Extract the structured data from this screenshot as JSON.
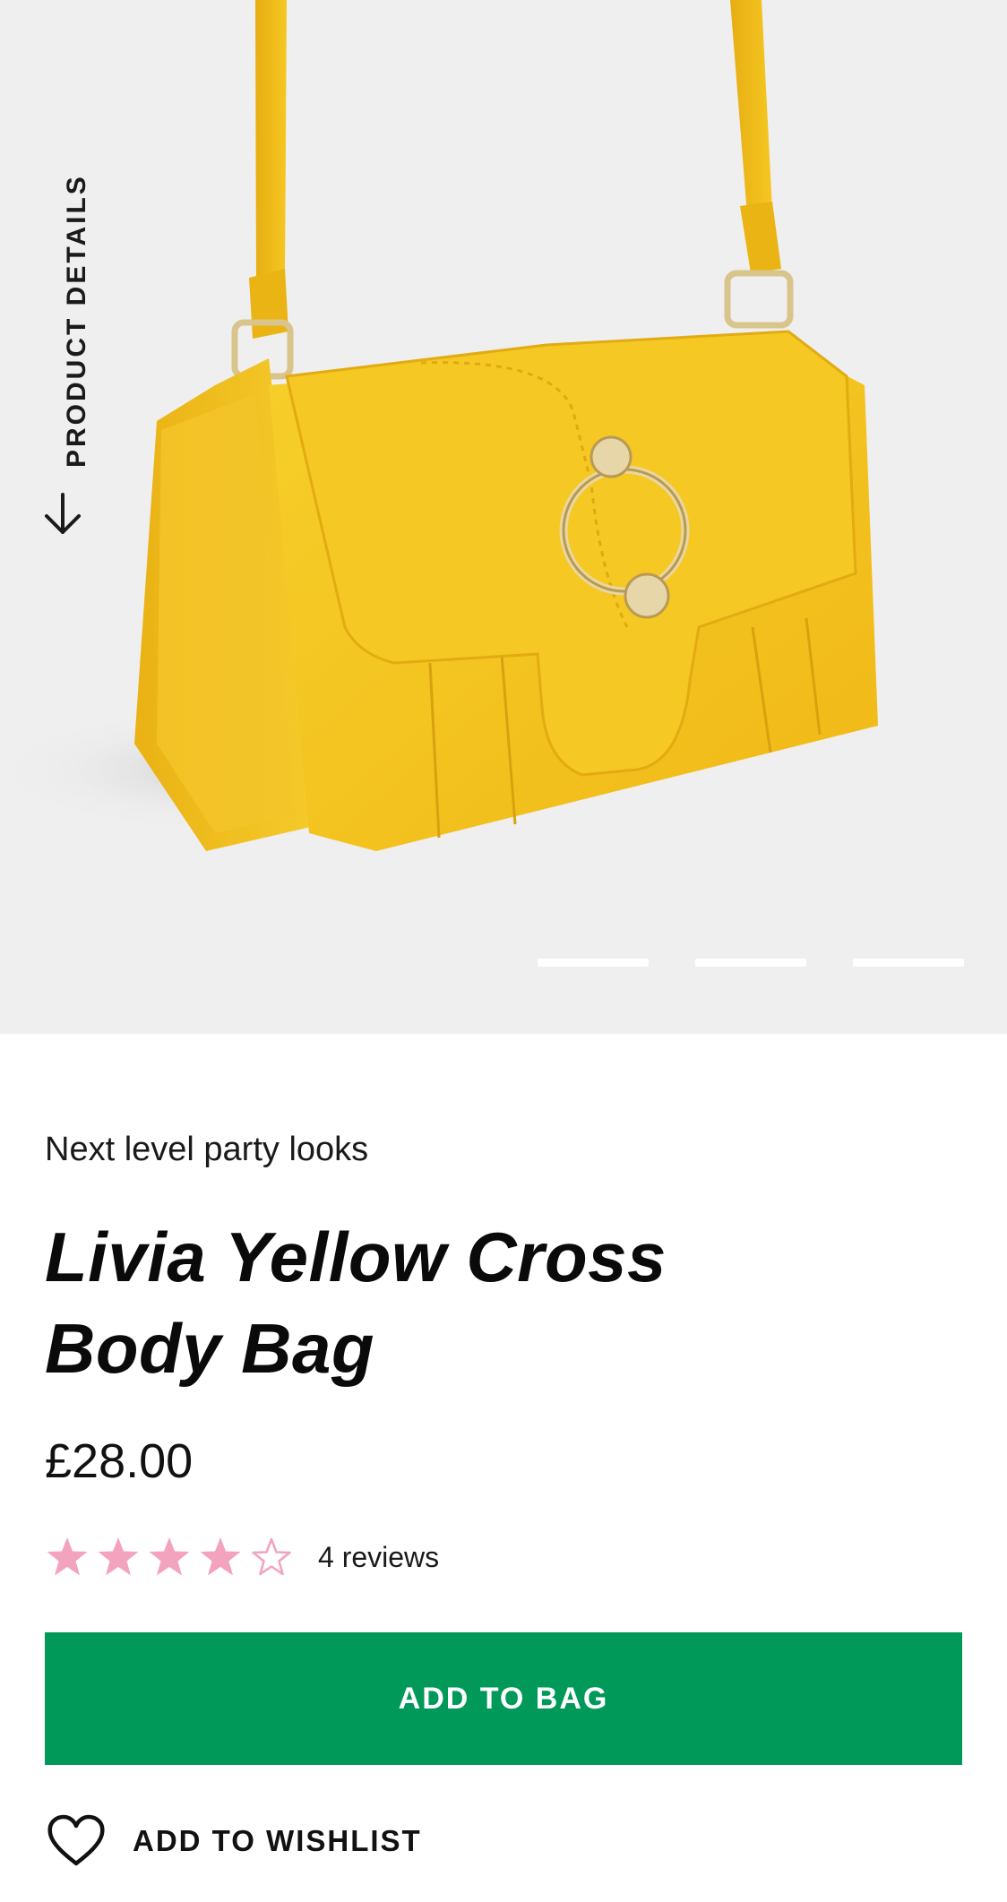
{
  "colors": {
    "hero_background": "#efefef",
    "add_to_bag_background": "#00995a",
    "add_to_bag_text": "#ffffff",
    "star_color": "#f3a3bd",
    "bag_color": "#f5c21b"
  },
  "hero": {
    "image_alt": "Livia Yellow Cross Body Bag product photo",
    "product_details_label": "PRODUCT DETAILS",
    "product_details_icon": "arrow-down-icon",
    "carousel": {
      "slide_count": 3
    }
  },
  "product": {
    "tagline": "Next level party looks",
    "title": "Livia Yellow Cross Body Bag",
    "price": "£28.00",
    "rating": {
      "value": 4,
      "max": 5,
      "reviews_label": "4 reviews"
    }
  },
  "actions": {
    "add_to_bag_label": "ADD TO BAG",
    "wishlist_label": "ADD TO WISHLIST",
    "wishlist_icon": "heart-icon"
  }
}
